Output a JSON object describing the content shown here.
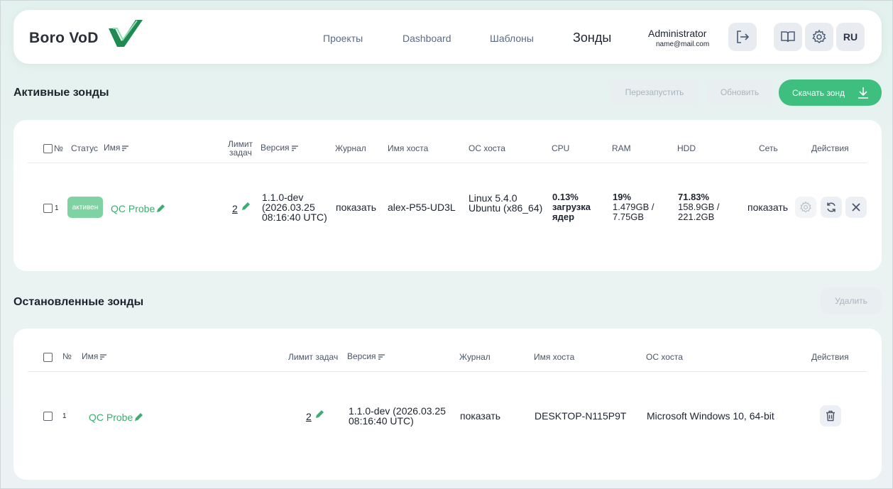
{
  "header": {
    "logo": "Boro VoD",
    "nav": [
      "Проекты",
      "Dashboard",
      "Шаблоны",
      "Зонды"
    ],
    "user_name": "Administrator",
    "user_email": "name@mail.com",
    "lang": "RU"
  },
  "active": {
    "title": "Активные зонды",
    "restart_label": "Перезапустить",
    "update_label": "Обновить",
    "download_label": "Скачать зонд",
    "columns": {
      "num": "№",
      "status": "Статус",
      "name": "Имя",
      "limit": [
        "Лимит",
        "задач"
      ],
      "version": "Версия",
      "journal": "Журнал",
      "host": "Имя хоста",
      "os": "ОС хоста",
      "cpu": "CPU",
      "ram": "RAM",
      "hdd": "HDD",
      "net": "Сеть",
      "actions": "Действия"
    },
    "row": {
      "num": "1",
      "status": "активен",
      "name": "QC Probe",
      "limit": "2",
      "version": [
        "1.1.0-dev",
        "(2026.03.25",
        "08:16:40 UTC)"
      ],
      "journal": "показать",
      "host": "alex-P55-UD3L",
      "os": [
        "Linux 5.4.0",
        "Ubuntu (x86_64)"
      ],
      "cpu": "0.13%",
      "cpu_link": [
        "загрузка",
        "ядер"
      ],
      "ram": [
        "19%",
        "1.479GB /",
        "7.75GB"
      ],
      "hdd": [
        "71.83%",
        "158.9GB /",
        "221.2GB"
      ],
      "net": "показать"
    }
  },
  "stopped": {
    "title": "Остановленные зонды",
    "delete_label": "Удалить",
    "columns": {
      "num": "№",
      "name": "Имя",
      "limit": "Лимит задач",
      "version": "Версия",
      "journal": "Журнал",
      "host": "Имя хоста",
      "os": "ОС хоста",
      "actions": "Действия"
    },
    "row": {
      "num": "1",
      "name": "QC Probe",
      "limit": "2",
      "version": [
        "1.1.0-dev (2026.03.25",
        "08:16:40 UTC)"
      ],
      "journal": "показать",
      "host": "DESKTOP-N115P9T",
      "os": "Microsoft Windows 10, 64-bit"
    }
  },
  "colors": {
    "accent": "#3fbf7f",
    "link": "#1fa0b7",
    "status_active": "#7fd3a3"
  }
}
